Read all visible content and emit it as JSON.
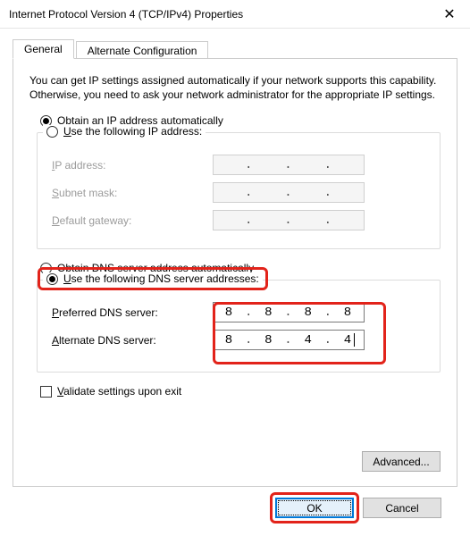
{
  "window": {
    "title": "Internet Protocol Version 4 (TCP/IPv4) Properties",
    "close_icon": "close-icon"
  },
  "tabs": {
    "general": "General",
    "alternate": "Alternate Configuration",
    "active": "general"
  },
  "description": "You can get IP settings assigned automatically if your network supports this capability. Otherwise, you need to ask your network administrator for the appropriate IP settings.",
  "ip_mode": {
    "auto_label_pre": "O",
    "auto_label_post": "btain an IP address automatically",
    "auto_checked": true,
    "manual_label_pre": "U",
    "manual_label_post": "se the following IP address:",
    "manual_checked": false,
    "fields": {
      "ip_label_pre": "I",
      "ip_label_post": "P address:",
      "mask_label_pre": "S",
      "mask_label_post": "ubnet mask:",
      "gw_label_pre": "D",
      "gw_label_post": "efault gateway:"
    }
  },
  "dns_mode": {
    "auto_label_pre": "O",
    "auto_label_post": "btain DNS server address automatically",
    "auto_checked": false,
    "manual_label_pre": "U",
    "manual_label_post": "se the following DNS server addresses:",
    "manual_checked": true,
    "preferred_label_pre": "P",
    "preferred_label_post": "referred DNS server:",
    "preferred_value": [
      "8",
      "8",
      "8",
      "8"
    ],
    "alternate_label_pre": "A",
    "alternate_label_post": "lternate DNS server:",
    "alternate_value": [
      "8",
      "8",
      "4",
      "4"
    ]
  },
  "validate": {
    "label_pre": "V",
    "label_post": "alidate settings upon exit",
    "checked": false
  },
  "buttons": {
    "advanced": "Advanced...",
    "ok": "OK",
    "cancel": "Cancel"
  },
  "highlights": {
    "dns_legend": true,
    "dns_inputs": true,
    "ok_button": true
  }
}
